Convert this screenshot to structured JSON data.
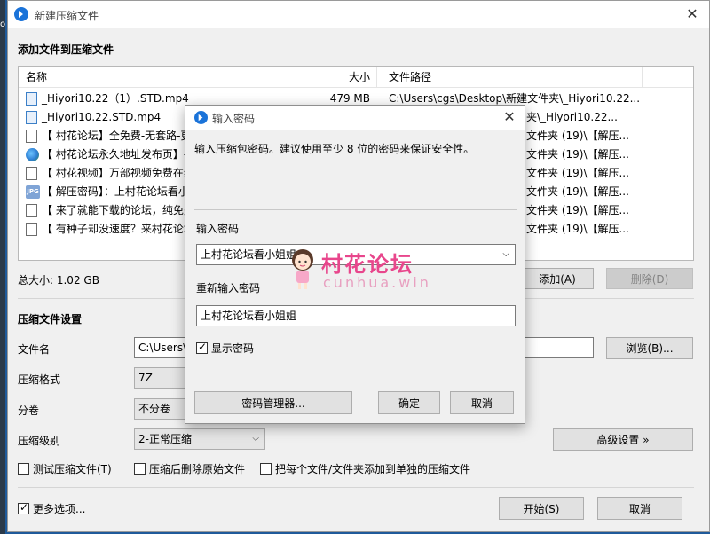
{
  "desktop": {
    "edge_text": "ot"
  },
  "main_window": {
    "title": "新建压缩文件",
    "section_add_files": "添加文件到压缩文件",
    "columns": {
      "name": "名称",
      "size": "大小",
      "path": "文件路径"
    },
    "files": [
      {
        "icon": "video-file-icon",
        "name": "_Hiyori10.22（1）.STD.mp4",
        "size": "479 MB",
        "path": "C:\\Users\\cgs\\Desktop\\新建文件夹\\_Hiyori10.22..."
      },
      {
        "icon": "video-file-icon",
        "name": "_Hiyori10.22.STD.mp4",
        "size": "",
        "path": "夹\\_Hiyori10.22..."
      },
      {
        "icon": "text-file-icon",
        "name": "【 村花论坛】全免费-无套路-更",
        "size": "",
        "path": "文件夹 (19)\\【解压..."
      },
      {
        "icon": "globe-file-icon",
        "name": "【 村花论坛永久地址发布页】-",
        "size": "",
        "path": "文件夹 (19)\\【解压..."
      },
      {
        "icon": "text-file-icon",
        "name": "【 村花视频】万部视频免费在线",
        "size": "",
        "path": "文件夹 (19)\\【解压..."
      },
      {
        "icon": "image-file-icon",
        "name": "【 解压密码】：上村花论坛看小",
        "size": "",
        "path": "文件夹 (19)\\【解压..."
      },
      {
        "icon": "text-file-icon",
        "name": "【 来了就能下载的论坛，纯免费",
        "size": "",
        "path": "文件夹 (19)\\【解压..."
      },
      {
        "icon": "text-file-icon",
        "name": "【 有种子却没速度？来村花论坛",
        "size": "",
        "path": "文件夹 (19)\\【解压..."
      }
    ],
    "total_size": "总大小: 1.02 GB",
    "add_button": "添加(A)",
    "remove_button": "删除(D)",
    "settings_title": "压缩文件设置",
    "filename_label": "文件名",
    "filename_value": "C:\\Users\\",
    "browse_button": "浏览(B)...",
    "format_label": "压缩格式",
    "format_value": "7Z",
    "volume_label": "分卷",
    "volume_value": "不分卷",
    "level_label": "压缩级别",
    "level_value": "2-正常压缩",
    "advanced_button": "高级设置 »",
    "test_checkbox": "测试压缩文件(T)",
    "delete_checkbox": "压缩后删除原始文件",
    "separate_checkbox": "把每个文件/文件夹添加到单独的压缩文件",
    "more_options": "更多选项...",
    "start_button": "开始(S)",
    "cancel_button": "取消"
  },
  "password_dialog": {
    "title": "输入密码",
    "hint": "输入压缩包密码。建议使用至少 8 位的密码来保证安全性。",
    "password_label": "输入密码",
    "password_value": "上村花论坛看小姐姐",
    "confirm_label": "重新输入密码",
    "confirm_value": "上村花论坛看小姐姐",
    "show_password": "显示密码",
    "manager_button": "密码管理器...",
    "ok_button": "确定",
    "cancel_button": "取消"
  },
  "watermark": {
    "title": "村花论坛",
    "subtitle": "cunhua.win"
  },
  "colors": {
    "accent": "#1a73d9",
    "watermark": "#e8468c"
  }
}
